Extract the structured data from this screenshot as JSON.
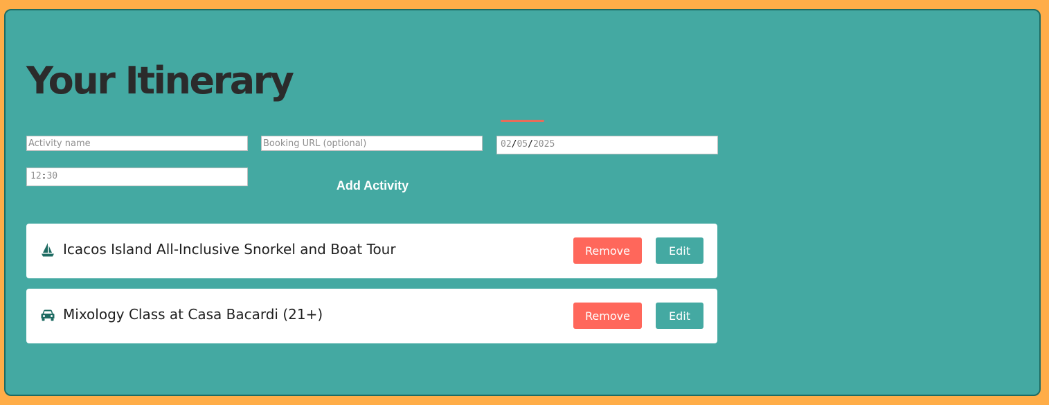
{
  "page": {
    "title": "Your Itinerary"
  },
  "form": {
    "activity_placeholder": "Activity name",
    "activity_value": "",
    "url_placeholder": "Booking URL (optional)",
    "url_value": "",
    "date": {
      "month": "02",
      "day": "05",
      "year": "2025",
      "separator": "/"
    },
    "time": {
      "hour": "12",
      "minute": "30",
      "separator": ":"
    },
    "add_button_label": "Add Activity"
  },
  "activities": [
    {
      "icon": "sailboat-icon",
      "name": "Icacos Island All-Inclusive Snorkel and Boat Tour",
      "remove_label": "Remove",
      "edit_label": "Edit"
    },
    {
      "icon": "car-icon",
      "name": "Mixology Class at Casa Bacardi (21+)",
      "remove_label": "Remove",
      "edit_label": "Edit"
    }
  ],
  "colors": {
    "page_background": "#FFAD48",
    "panel_background": "#44A9A2",
    "panel_border": "#1E6B62",
    "title_text": "#2B2B2B",
    "accent_line": "#E86C5A",
    "remove_button": "#FF675B",
    "edit_button": "#44A9A2",
    "icon_color": "#1E6B62"
  }
}
